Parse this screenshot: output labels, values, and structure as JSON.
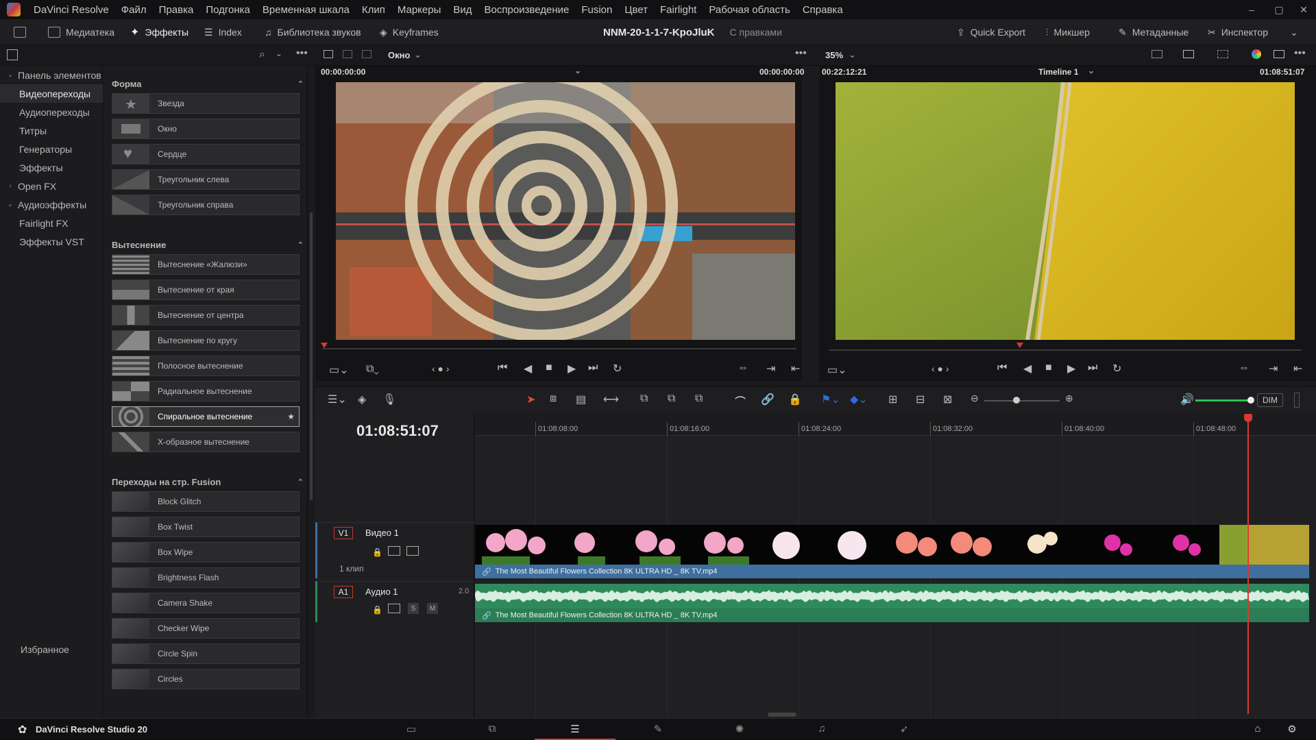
{
  "menubar": {
    "items": [
      "DaVinci Resolve",
      "Файл",
      "Правка",
      "Подгонка",
      "Временная шкала",
      "Клип",
      "Маркеры",
      "Вид",
      "Воспроизведение",
      "Fusion",
      "Цвет",
      "Fairlight",
      "Рабочая область",
      "Справка"
    ],
    "window_controls": [
      "–",
      "▢",
      "✕"
    ]
  },
  "toolbar": {
    "media": "Медиатека",
    "effects": "Эффекты",
    "index": "Index",
    "sound_library": "Библиотека звуков",
    "keyframes": "Keyframes",
    "project_title": "NNM-20-1-1-7-KpoJluK",
    "project_status": "С правками",
    "quick_export": "Quick Export",
    "mixer": "Микшер",
    "metadata": "Метаданные",
    "inspector": "Инспектор"
  },
  "subbar": {
    "source_mode": "Окно",
    "zoom": "35%",
    "source_tc_left": "00:00:00:00",
    "source_tc_right": "00:00:00:00",
    "record_tc_left": "00:22:12:21",
    "timeline_name": "Timeline 1",
    "record_tc_right": "01:08:51:07"
  },
  "tree": {
    "items": [
      {
        "label": "Панель элементов",
        "arrow": "⌄",
        "indent": 0
      },
      {
        "label": "Видеопереходы",
        "arrow": "",
        "indent": 1,
        "selected": true
      },
      {
        "label": "Аудиопереходы",
        "arrow": "",
        "indent": 1
      },
      {
        "label": "Титры",
        "arrow": "›",
        "indent": 1
      },
      {
        "label": "Генераторы",
        "arrow": "",
        "indent": 1
      },
      {
        "label": "Эффекты",
        "arrow": "",
        "indent": 1
      },
      {
        "label": "Open FX",
        "arrow": "›",
        "indent": 0
      },
      {
        "label": "Аудиоэффекты",
        "arrow": "⌄",
        "indent": 0
      },
      {
        "label": "Fairlight FX",
        "arrow": "",
        "indent": 1
      },
      {
        "label": "Эффекты VST",
        "arrow": "",
        "indent": 1
      }
    ],
    "favorites": "Избранное"
  },
  "effects": {
    "sections": [
      {
        "title": "Форма",
        "items": [
          "Звезда",
          "Окно",
          "Сердце",
          "Треугольник слева",
          "Треугольник справа"
        ]
      },
      {
        "title": "Вытеснение",
        "items": [
          "Вытеснение «Жалюзи»",
          "Вытеснение от края",
          "Вытеснение от центра",
          "Вытеснение по кругу",
          "Полосное вытеснение",
          "Радиальное вытеснение",
          "Спиральное вытеснение",
          "X-образное вытеснение"
        ]
      },
      {
        "title": "Переходы на стр. Fusion",
        "items": [
          "Block Glitch",
          "Box Twist",
          "Box Wipe",
          "Brightness Flash",
          "Camera Shake",
          "Checker Wipe",
          "Circle Spin",
          "Circles"
        ]
      }
    ],
    "selected": "Спиральное вытеснение"
  },
  "timeline": {
    "timecode": "01:08:51:07",
    "ruler": [
      "01:08:08:00",
      "01:08:16:00",
      "01:08:24:00",
      "01:08:32:00",
      "01:08:40:00",
      "01:08:48:00"
    ],
    "v1": {
      "tag": "V1",
      "name": "Видео 1",
      "clips": "1 клип",
      "clip_name": "The Most Beautiful Flowers Collection 8K ULTRA HD _ 8K TV.mp4"
    },
    "a1": {
      "tag": "A1",
      "name": "Аудио 1",
      "channels": "2.0",
      "solo": "S",
      "mute": "M",
      "clip_name": "The Most Beautiful Flowers Collection 8K ULTRA HD _ 8K TV.mp4"
    },
    "dim": "DIM"
  },
  "bottom": {
    "app_name": "DaVinci Resolve Studio 20"
  },
  "colors": {
    "accent_playhead": "#d83a32",
    "video_clip": "#3f6f9e",
    "audio_clip": "#2e8a5d",
    "volume_green": "#2fbf4f"
  }
}
